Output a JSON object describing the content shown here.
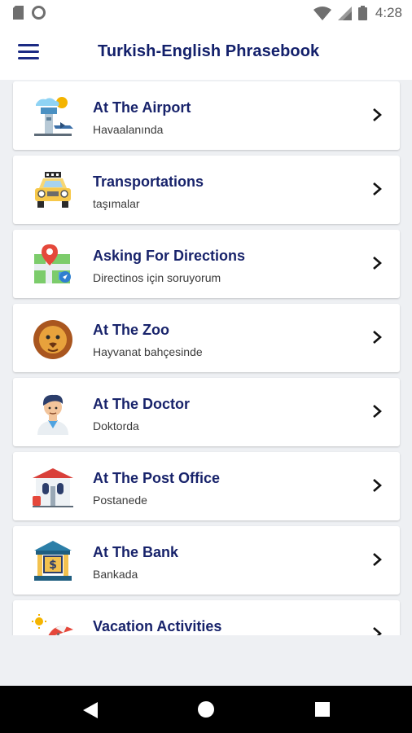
{
  "status_bar": {
    "time": "4:28",
    "left_icons": [
      "sim-card-icon",
      "circle-notification-icon"
    ],
    "right_icons": [
      "wifi-icon",
      "signal-icon",
      "battery-icon"
    ]
  },
  "app_bar": {
    "title": "Turkish-English Phrasebook",
    "menu_icon": "hamburger-menu-icon"
  },
  "categories": [
    {
      "title": "At The Airport",
      "subtitle": "Havaalanında",
      "icon": "airport-icon"
    },
    {
      "title": "Transportations",
      "subtitle": "taşımalar",
      "icon": "taxi-icon"
    },
    {
      "title": "Asking For Directions",
      "subtitle": "Directinos için soruyorum",
      "icon": "map-pin-icon"
    },
    {
      "title": "At The Zoo",
      "subtitle": "Hayvanat bahçesinde",
      "icon": "lion-icon"
    },
    {
      "title": "At The Doctor",
      "subtitle": "Doktorda",
      "icon": "doctor-icon"
    },
    {
      "title": "At The Post Office",
      "subtitle": "Postanede",
      "icon": "post-office-icon"
    },
    {
      "title": "At The Bank",
      "subtitle": "Bankada",
      "icon": "bank-icon"
    },
    {
      "title": "Vacation Activities",
      "subtitle": "",
      "icon": "beach-umbrella-icon"
    }
  ],
  "nav_bar": {
    "buttons": [
      "back-icon",
      "home-icon",
      "recents-icon"
    ]
  },
  "colors": {
    "title": "#13206b",
    "accent": "#1b2a83",
    "background": "#eef0f3"
  }
}
